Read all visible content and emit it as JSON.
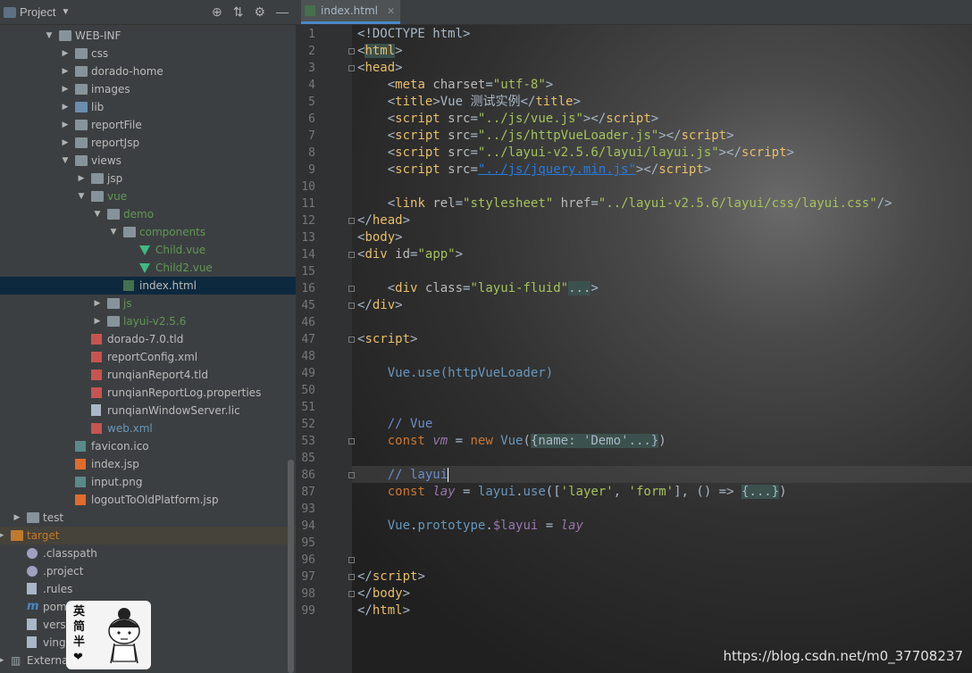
{
  "project_panel": {
    "title": "Project",
    "tree": [
      {
        "label": "WEB-INF",
        "icon": "folder-icon",
        "depth": 3,
        "arrow": "down"
      },
      {
        "label": "css",
        "icon": "folder-icon",
        "depth": 4,
        "arrow": "right"
      },
      {
        "label": "dorado-home",
        "icon": "folder-icon",
        "depth": 4,
        "arrow": "right"
      },
      {
        "label": "images",
        "icon": "folder-icon",
        "depth": 4,
        "arrow": "right"
      },
      {
        "label": "lib",
        "icon": "library-folder-icon",
        "depth": 4,
        "arrow": "right"
      },
      {
        "label": "reportFile",
        "icon": "folder-icon",
        "depth": 4,
        "arrow": "right"
      },
      {
        "label": "reportJsp",
        "icon": "folder-icon",
        "depth": 4,
        "arrow": "right"
      },
      {
        "label": "views",
        "icon": "folder-icon",
        "depth": 4,
        "arrow": "down"
      },
      {
        "label": "jsp",
        "icon": "folder-icon",
        "depth": 5,
        "arrow": "right"
      },
      {
        "label": "vue",
        "icon": "folder-icon",
        "depth": 5,
        "arrow": "down",
        "color": "green"
      },
      {
        "label": "demo",
        "icon": "folder-icon",
        "depth": 6,
        "arrow": "down",
        "color": "green"
      },
      {
        "label": "components",
        "icon": "folder-icon",
        "depth": 7,
        "arrow": "down",
        "color": "green"
      },
      {
        "label": "Child.vue",
        "icon": "vue-file-icon",
        "depth": 8,
        "color": "green"
      },
      {
        "label": "Child2.vue",
        "icon": "vue-file-icon",
        "depth": 8,
        "color": "green"
      },
      {
        "label": "index.html",
        "icon": "html-file-icon",
        "depth": 7,
        "selected": true
      },
      {
        "label": "js",
        "icon": "folder-icon",
        "depth": 6,
        "arrow": "right",
        "color": "green"
      },
      {
        "label": "layui-v2.5.6",
        "icon": "folder-icon",
        "depth": 6,
        "arrow": "right",
        "color": "green"
      },
      {
        "label": "dorado-7.0.tld",
        "icon": "xml-file-icon",
        "depth": 5
      },
      {
        "label": "reportConfig.xml",
        "icon": "xml-file-icon",
        "depth": 5
      },
      {
        "label": "runqianReport4.tld",
        "icon": "xml-file-icon",
        "depth": 5
      },
      {
        "label": "runqianReportLog.properties",
        "icon": "properties-file-icon",
        "depth": 5
      },
      {
        "label": "runqianWindowServer.lic",
        "icon": "text-file-icon",
        "depth": 5
      },
      {
        "label": "web.xml",
        "icon": "xml-file-icon",
        "depth": 5,
        "color": "blue"
      },
      {
        "label": "favicon.ico",
        "icon": "image-file-icon",
        "depth": 4
      },
      {
        "label": "index.jsp",
        "icon": "jsp-file-icon",
        "depth": 4
      },
      {
        "label": "input.png",
        "icon": "image-file-icon",
        "depth": 4
      },
      {
        "label": "logoutToOldPlatform.jsp",
        "icon": "jsp-file-icon",
        "depth": 4
      },
      {
        "label": "test",
        "icon": "folder-icon",
        "depth": 1,
        "arrow": "right"
      },
      {
        "label": "target",
        "icon": "target-folder-icon",
        "depth": 0,
        "arrow": "right",
        "color": "orange",
        "highlight": true
      },
      {
        "label": ".classpath",
        "icon": "eclipse-file-icon",
        "depth": 1
      },
      {
        "label": ".project",
        "icon": "eclipse-file-icon",
        "depth": 1
      },
      {
        "label": ".rules",
        "icon": "text-file-icon",
        "depth": 1
      },
      {
        "label": "pom.xml",
        "icon": "maven-file-icon",
        "depth": 1
      },
      {
        "label": "version.txt",
        "icon": "text-file-icon",
        "depth": 1
      },
      {
        "label": "vingroup.xml",
        "icon": "text-file-icon",
        "depth": 1
      },
      {
        "label": "External Libraries",
        "icon": "libraries-icon",
        "depth": 0,
        "arrow": "right"
      }
    ]
  },
  "sticker": {
    "chars": [
      "英",
      "简",
      "半",
      "❤"
    ]
  },
  "editor": {
    "tab_label": "index.html",
    "line_numbers": [
      "1",
      "2",
      "3",
      "4",
      "5",
      "6",
      "7",
      "8",
      "9",
      "10",
      "11",
      "12",
      "13",
      "14",
      "15",
      "16",
      "45",
      "46",
      "47",
      "48",
      "49",
      "50",
      "51",
      "52",
      "53",
      "85",
      "86",
      "87",
      "93",
      "94",
      "95",
      "96",
      "97",
      "98",
      "99"
    ],
    "code": {
      "l1": "<!DOCTYPE html>",
      "l5_title": "Vue 测试实例",
      "l6_src": "\"../js/vue.js\"",
      "l7_src": "\"../js/httpVueLoader.js\"",
      "l8_src": "\"../layui-v2.5.6/layui/layui.js\"",
      "l9_src": "\"../js/jquery.min.js\"",
      "l11_href": "\"../layui-v2.5.6/layui/css/layui.css\"",
      "l14_id": "\"app\"",
      "l16_class": "\"layui-fluid\"",
      "l49": "Vue.use(httpVueLoader)",
      "l52": "// Vue",
      "l53_fold": "{name: 'Demo'...}",
      "l86": "// layui",
      "l87_layer": "'layer'",
      "l87_form": "'form'",
      "l87_fold": "{...}",
      "l93_prop": "$layui",
      "l93_var": "lay"
    }
  },
  "watermark": "https://blog.csdn.net/m0_37708237"
}
